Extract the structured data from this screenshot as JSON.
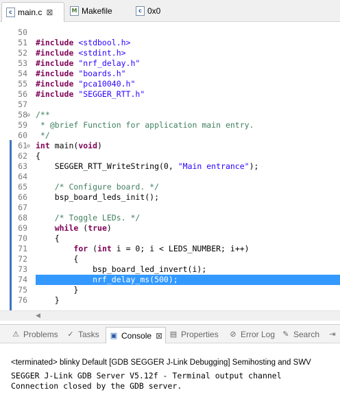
{
  "editor_tabs": [
    {
      "label": "main.c",
      "icon": "c-file-icon",
      "close": "⊠",
      "active": true
    },
    {
      "label": "Makefile",
      "icon": "makefile-icon",
      "active": false
    },
    {
      "label": "0x0",
      "icon": "memory-icon",
      "active": false
    }
  ],
  "code_lines": [
    {
      "n": "50",
      "segs": [
        {
          "t": "",
          "c": ""
        }
      ]
    },
    {
      "n": "51",
      "segs": [
        {
          "t": "#include ",
          "c": "pp"
        },
        {
          "t": "<stdbool.h>",
          "c": "str"
        }
      ]
    },
    {
      "n": "52",
      "segs": [
        {
          "t": "#include ",
          "c": "pp"
        },
        {
          "t": "<stdint.h>",
          "c": "str"
        }
      ]
    },
    {
      "n": "53",
      "segs": [
        {
          "t": "#include ",
          "c": "pp"
        },
        {
          "t": "\"nrf_delay.h\"",
          "c": "str"
        }
      ]
    },
    {
      "n": "54",
      "segs": [
        {
          "t": "#include ",
          "c": "pp"
        },
        {
          "t": "\"boards.h\"",
          "c": "str"
        }
      ]
    },
    {
      "n": "55",
      "segs": [
        {
          "t": "#include ",
          "c": "pp"
        },
        {
          "t": "\"pca10040.h\"",
          "c": "str"
        }
      ]
    },
    {
      "n": "56",
      "segs": [
        {
          "t": "#include ",
          "c": "pp"
        },
        {
          "t": "\"SEGGER_RTT.h\"",
          "c": "str"
        }
      ]
    },
    {
      "n": "57",
      "segs": [
        {
          "t": "",
          "c": ""
        }
      ]
    },
    {
      "n": "58",
      "fold": "⊖",
      "segs": [
        {
          "t": "/**",
          "c": "cm"
        }
      ]
    },
    {
      "n": "59",
      "segs": [
        {
          "t": " * @brief Function for application main entry.",
          "c": "cm"
        }
      ]
    },
    {
      "n": "60",
      "segs": [
        {
          "t": " */",
          "c": "cm"
        }
      ]
    },
    {
      "n": "61",
      "fold": "⊖",
      "segs": [
        {
          "t": "int ",
          "c": "kw"
        },
        {
          "t": "main(",
          "c": ""
        },
        {
          "t": "void",
          "c": "kw"
        },
        {
          "t": ")",
          "c": ""
        }
      ]
    },
    {
      "n": "62",
      "segs": [
        {
          "t": "{",
          "c": ""
        }
      ]
    },
    {
      "n": "63",
      "segs": [
        {
          "t": "    SEGGER_RTT_WriteString(0, ",
          "c": ""
        },
        {
          "t": "\"Main entrance\"",
          "c": "str"
        },
        {
          "t": ");",
          "c": ""
        }
      ]
    },
    {
      "n": "64",
      "segs": [
        {
          "t": "",
          "c": ""
        }
      ]
    },
    {
      "n": "65",
      "segs": [
        {
          "t": "    /* Configure board. */",
          "c": "cm"
        }
      ]
    },
    {
      "n": "66",
      "segs": [
        {
          "t": "    bsp_board_leds_init();",
          "c": ""
        }
      ]
    },
    {
      "n": "67",
      "segs": [
        {
          "t": "",
          "c": ""
        }
      ]
    },
    {
      "n": "68",
      "segs": [
        {
          "t": "    /* Toggle LEDs. */",
          "c": "cm"
        }
      ]
    },
    {
      "n": "69",
      "segs": [
        {
          "t": "    ",
          "c": ""
        },
        {
          "t": "while ",
          "c": "kw"
        },
        {
          "t": "(",
          "c": ""
        },
        {
          "t": "true",
          "c": "kw"
        },
        {
          "t": ")",
          "c": ""
        }
      ]
    },
    {
      "n": "70",
      "segs": [
        {
          "t": "    {",
          "c": ""
        }
      ]
    },
    {
      "n": "71",
      "segs": [
        {
          "t": "        ",
          "c": ""
        },
        {
          "t": "for ",
          "c": "kw"
        },
        {
          "t": "(",
          "c": ""
        },
        {
          "t": "int ",
          "c": "kw"
        },
        {
          "t": "i = 0; i < LEDS_NUMBER; i++)",
          "c": ""
        }
      ]
    },
    {
      "n": "72",
      "segs": [
        {
          "t": "        {",
          "c": ""
        }
      ]
    },
    {
      "n": "73",
      "segs": [
        {
          "t": "            bsp_board_led_invert(i);",
          "c": ""
        }
      ]
    },
    {
      "n": "74",
      "highlight": true,
      "segs": [
        {
          "t": "            nrf_delay_ms(500);",
          "c": ""
        }
      ]
    },
    {
      "n": "75",
      "segs": [
        {
          "t": "        }",
          "c": ""
        }
      ]
    },
    {
      "n": "76",
      "segs": [
        {
          "t": "    }",
          "c": ""
        }
      ]
    }
  ],
  "view_tabs": [
    {
      "label": "Problems",
      "icon": "problems-icon",
      "glyph": "⚠",
      "active": false
    },
    {
      "label": "Tasks",
      "icon": "tasks-icon",
      "glyph": "✓",
      "active": false
    },
    {
      "label": "Console",
      "icon": "console-icon",
      "glyph": "▣",
      "active": true,
      "close": "⊠"
    },
    {
      "label": "Properties",
      "icon": "properties-icon",
      "glyph": "▤",
      "active": false
    },
    {
      "label": "Error Log",
      "icon": "error-log-icon",
      "glyph": "⊘",
      "active": false
    },
    {
      "label": "Search",
      "icon": "search-icon",
      "glyph": "✎",
      "active": false
    },
    {
      "label": "I",
      "icon": "more-icon",
      "glyph": "⇥",
      "active": false
    }
  ],
  "console": {
    "title": "<terminated> blinky Default [GDB SEGGER J-Link Debugging] Semihosting and SWV",
    "lines": [
      "SEGGER J-Link GDB Server V5.12f - Terminal output channel",
      "Connection closed by the GDB server."
    ]
  },
  "colors": {
    "selection": "#3399ff",
    "keyword": "#7f0055",
    "string": "#2a00ff",
    "comment": "#3f7f5f"
  }
}
